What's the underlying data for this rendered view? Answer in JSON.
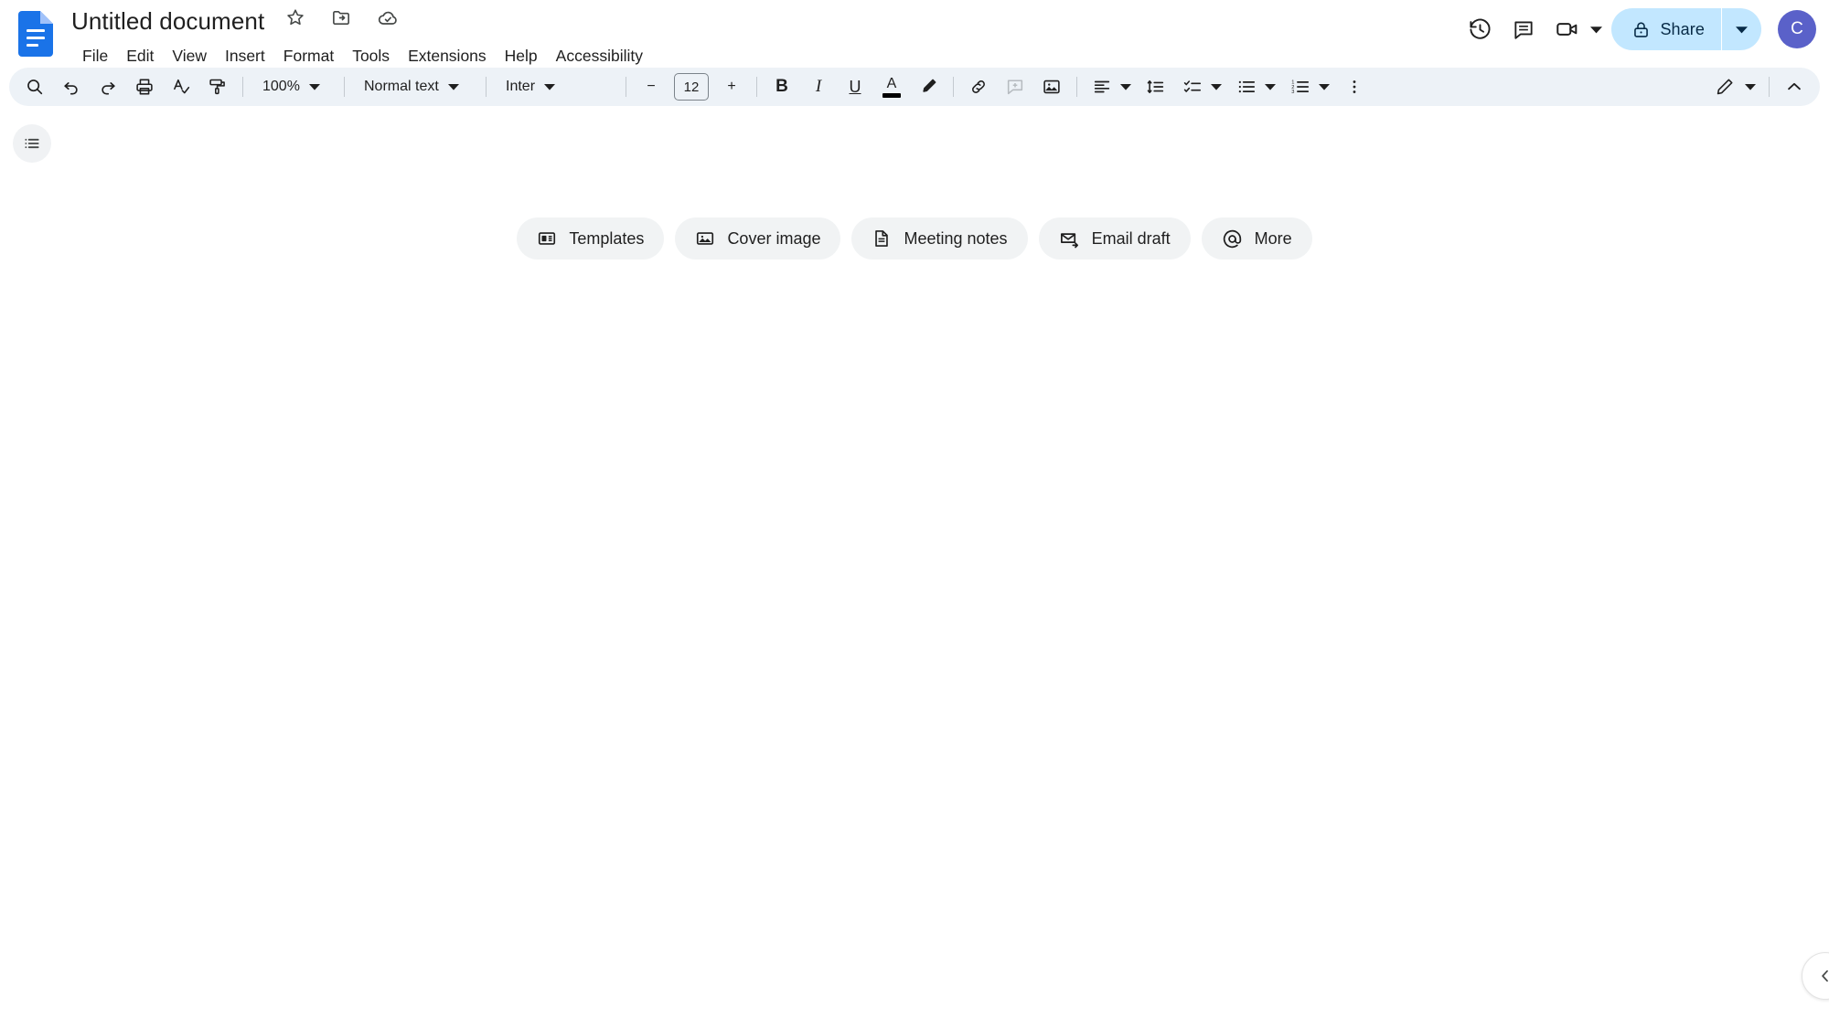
{
  "header": {
    "app_icon": "google-docs-icon",
    "doc_title": "Untitled document",
    "title_icons": [
      {
        "name": "star-icon",
        "label": "Star"
      },
      {
        "name": "move-to-folder-icon",
        "label": "Move"
      },
      {
        "name": "cloud-saved-icon",
        "label": "Saved to Drive"
      }
    ],
    "menu": [
      {
        "name": "menu-file",
        "label": "File"
      },
      {
        "name": "menu-edit",
        "label": "Edit"
      },
      {
        "name": "menu-view",
        "label": "View"
      },
      {
        "name": "menu-insert",
        "label": "Insert"
      },
      {
        "name": "menu-format",
        "label": "Format"
      },
      {
        "name": "menu-tools",
        "label": "Tools"
      },
      {
        "name": "menu-extensions",
        "label": "Extensions"
      },
      {
        "name": "menu-help",
        "label": "Help"
      },
      {
        "name": "menu-accessibility",
        "label": "Accessibility"
      }
    ],
    "actions": {
      "history_icon": "version-history-icon",
      "comment_icon": "comment-history-icon",
      "meet_icon": "meet-camera-icon",
      "share_label": "Share",
      "avatar_initial": "C"
    }
  },
  "toolbar": {
    "search_label": "Search",
    "undo_label": "Undo",
    "redo_label": "Redo",
    "print_label": "Print",
    "spellcheck_label": "Spelling and grammar check",
    "paint_label": "Paint format",
    "zoom_value": "100%",
    "style_value": "Normal text",
    "font_value": "Inter",
    "font_size_value": "12",
    "decrease_font_label": "−",
    "increase_font_label": "+",
    "bold_label": "B",
    "italic_label": "I",
    "underline_label": "U",
    "text_color_label": "A",
    "highlight_label": "Highlight color",
    "link_label": "Insert link",
    "comment_label": "Add comment",
    "image_label": "Insert image",
    "align_label": "Align",
    "line_spacing_label": "Line & paragraph spacing",
    "checklist_label": "Checklist",
    "bulleted_list_label": "Bulleted list",
    "numbered_list_label": "Numbered list",
    "more_label": "More",
    "edit_mode_label": "Editing mode",
    "collapse_label": "Hide the menus"
  },
  "body": {
    "outline_button_label": "Show document outline",
    "chips": [
      {
        "name": "chip-templates",
        "icon": "templates-icon",
        "label": "Templates"
      },
      {
        "name": "chip-cover-image",
        "icon": "image-icon",
        "label": "Cover image"
      },
      {
        "name": "chip-meeting-notes",
        "icon": "document-icon",
        "label": "Meeting notes"
      },
      {
        "name": "chip-email-draft",
        "icon": "email-draft-icon",
        "label": "Email draft"
      },
      {
        "name": "chip-more",
        "icon": "at-mention-icon",
        "label": "More"
      }
    ],
    "side_expander_label": "Open side panel"
  },
  "colors": {
    "accent_blue": "#1a73e8",
    "share_bg": "#c2e7ff",
    "share_text": "#072a46",
    "avatar_bg": "#5a61c9",
    "toolbar_bg": "#edf2f7",
    "chip_bg": "#f1f3f4",
    "text_primary": "#1f1f1f"
  }
}
